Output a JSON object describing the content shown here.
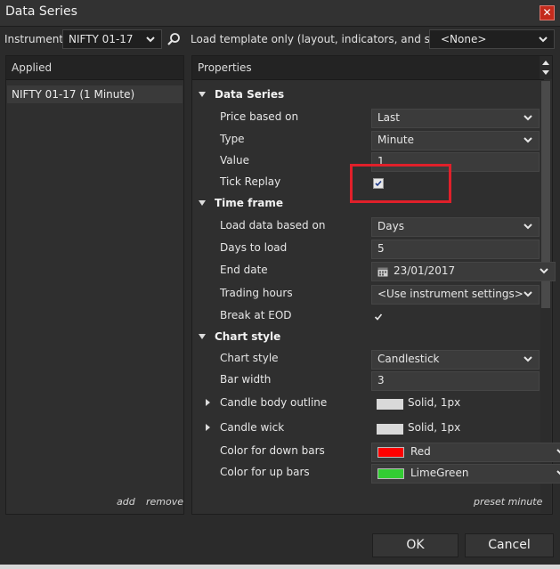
{
  "window": {
    "title": "Data Series"
  },
  "toolbar": {
    "instrument_label": "Instrument",
    "instrument_value": "NIFTY 01-17",
    "template_label": "Load template only (layout, indicators, and style)",
    "template_value": "<None>"
  },
  "applied": {
    "header": "Applied",
    "items": [
      "NIFTY 01-17 (1 Minute)"
    ],
    "add_label": "add",
    "remove_label": "remove"
  },
  "properties": {
    "header": "Properties",
    "preset_label": "preset minute",
    "data_series": {
      "title": "Data Series",
      "price_based_on": {
        "label": "Price based on",
        "value": "Last"
      },
      "type": {
        "label": "Type",
        "value": "Minute"
      },
      "value": {
        "label": "Value",
        "value": "1"
      },
      "tick_replay": {
        "label": "Tick Replay",
        "checked": true
      }
    },
    "time_frame": {
      "title": "Time frame",
      "load_data_based_on": {
        "label": "Load data based on",
        "value": "Days"
      },
      "days_to_load": {
        "label": "Days to load",
        "value": "5"
      },
      "end_date": {
        "label": "End date",
        "value": "23/01/2017"
      },
      "trading_hours": {
        "label": "Trading hours",
        "value": "<Use instrument settings>"
      },
      "break_at_eod": {
        "label": "Break at EOD",
        "checked": true
      }
    },
    "chart_style": {
      "title": "Chart style",
      "chart_style": {
        "label": "Chart style",
        "value": "Candlestick"
      },
      "bar_width": {
        "label": "Bar width",
        "value": "3"
      },
      "candle_body_outline": {
        "label": "Candle body outline",
        "value": "Solid, 1px",
        "color": "#d9d9d9"
      },
      "candle_wick": {
        "label": "Candle wick",
        "value": "Solid, 1px",
        "color": "#d9d9d9"
      },
      "color_down_bars": {
        "label": "Color for down bars",
        "value": "Red",
        "color": "#ff0000"
      },
      "color_up_bars": {
        "label": "Color for up bars",
        "value": "LimeGreen",
        "color": "#32cd32"
      }
    }
  },
  "buttons": {
    "ok": "OK",
    "cancel": "Cancel"
  },
  "icons": {
    "search": "search-icon",
    "close": "close-icon",
    "calendar": "calendar-icon"
  },
  "colors": {
    "highlight": "#e0202a",
    "background": "#2b2b2b"
  }
}
